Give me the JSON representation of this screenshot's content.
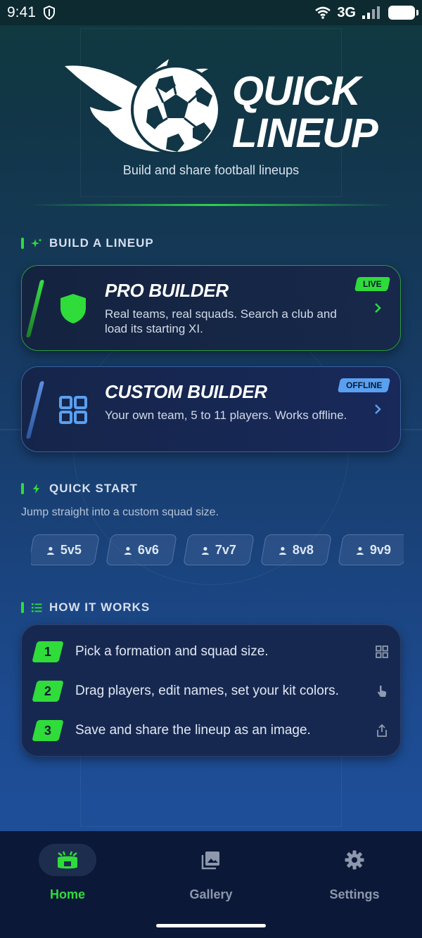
{
  "status_bar": {
    "time": "9:41",
    "network": "3G"
  },
  "hero": {
    "logo_line1": "QUICK",
    "logo_line2": "LINEUP",
    "tagline": "Build and share football lineups"
  },
  "build_section": {
    "title": "BUILD A LINEUP",
    "cards": [
      {
        "title": "PRO BUILDER",
        "description": "Real teams, real squads. Search a club and load its starting XI.",
        "badge": "LIVE",
        "icon": "shield-icon"
      },
      {
        "title": "CUSTOM BUILDER",
        "description": "Your own team, 5 to 11 players. Works offline.",
        "badge": "OFFLINE",
        "icon": "grid-icon"
      }
    ]
  },
  "quick_start": {
    "title": "QUICK START",
    "subtitle": "Jump straight into a custom squad size.",
    "chips": [
      "5v5",
      "6v6",
      "7v7",
      "8v8",
      "9v9"
    ]
  },
  "how_it_works": {
    "title": "HOW IT WORKS",
    "steps": [
      {
        "number": "1",
        "text": "Pick a formation and squad size.",
        "icon": "grid-icon"
      },
      {
        "number": "2",
        "text": "Drag players, edit names, set your kit colors.",
        "icon": "touch-icon"
      },
      {
        "number": "3",
        "text": "Save and share the lineup as an image.",
        "icon": "share-icon"
      }
    ]
  },
  "bottom_nav": [
    {
      "label": "Home",
      "icon": "stadium-icon",
      "active": true
    },
    {
      "label": "Gallery",
      "icon": "gallery-icon",
      "active": false
    },
    {
      "label": "Settings",
      "icon": "gear-icon",
      "active": false
    }
  ],
  "colors": {
    "accent": "#2fdc3a",
    "offline": "#5aa0f0",
    "background": "#163a63"
  }
}
